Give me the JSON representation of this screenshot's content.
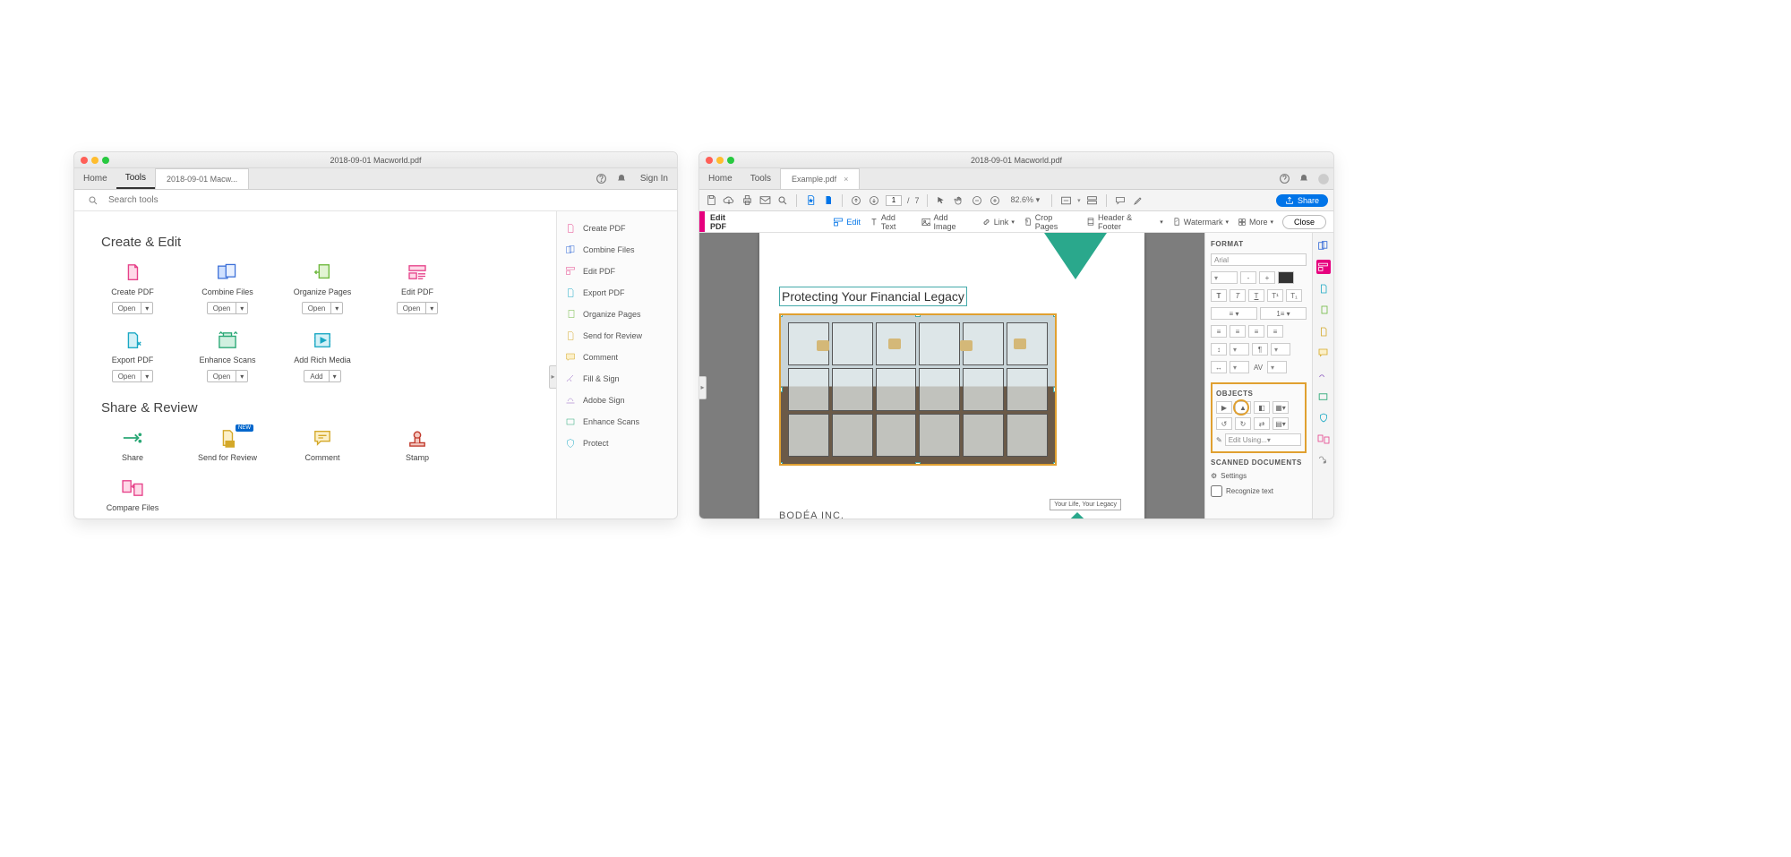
{
  "w1": {
    "title": "2018-09-01 Macworld.pdf",
    "nav": {
      "home": "Home",
      "tools": "Tools"
    },
    "doctab": "2018-09-01 Macw...",
    "signin": "Sign In",
    "search_ph": "Search tools",
    "sec1": "Create & Edit",
    "sec2": "Share & Review",
    "tools1": [
      {
        "name": "Create PDF",
        "btn": "Open"
      },
      {
        "name": "Combine Files",
        "btn": "Open"
      },
      {
        "name": "Organize Pages",
        "btn": "Open"
      },
      {
        "name": "Edit PDF",
        "btn": "Open"
      },
      {
        "name": "Export PDF",
        "btn": "Open"
      },
      {
        "name": "Enhance Scans",
        "btn": "Open"
      },
      {
        "name": "Add Rich Media",
        "btn": "Add"
      }
    ],
    "tools2": [
      {
        "name": "Share",
        "badge": ""
      },
      {
        "name": "Send for Review",
        "badge": "NEW"
      },
      {
        "name": "Comment",
        "badge": ""
      },
      {
        "name": "Stamp",
        "badge": ""
      },
      {
        "name": "Compare Files",
        "badge": ""
      }
    ],
    "side": [
      "Create PDF",
      "Combine Files",
      "Edit PDF",
      "Export PDF",
      "Organize Pages",
      "Send for Review",
      "Comment",
      "Fill & Sign",
      "Adobe Sign",
      "Enhance Scans",
      "Protect"
    ]
  },
  "w2": {
    "title": "2018-09-01 Macworld.pdf",
    "nav": {
      "home": "Home",
      "tools": "Tools"
    },
    "doctab": "Example.pdf",
    "page_cur": "1",
    "page_sep": "/",
    "page_tot": "7",
    "zoom": "82.6%",
    "share": "Share",
    "editbar_title": "Edit PDF",
    "eb": {
      "edit": "Edit",
      "addtext": "Add Text",
      "addimg": "Add Image",
      "link": "Link",
      "crop": "Crop Pages",
      "hf": "Header & Footer",
      "wm": "Watermark",
      "more": "More"
    },
    "close": "Close",
    "doc": {
      "heading": "Protecting Your Financial Legacy",
      "brand": "BODÉA INC.",
      "tag": "Your Life, Your Legacy"
    },
    "fmt": {
      "hdr": "FORMAT",
      "font": "Arial",
      "obj": "OBJECTS",
      "editusing": "Edit Using...",
      "scan": "SCANNED DOCUMENTS",
      "settings": "Settings",
      "recog": "Recognize text",
      "av": "AV"
    }
  }
}
